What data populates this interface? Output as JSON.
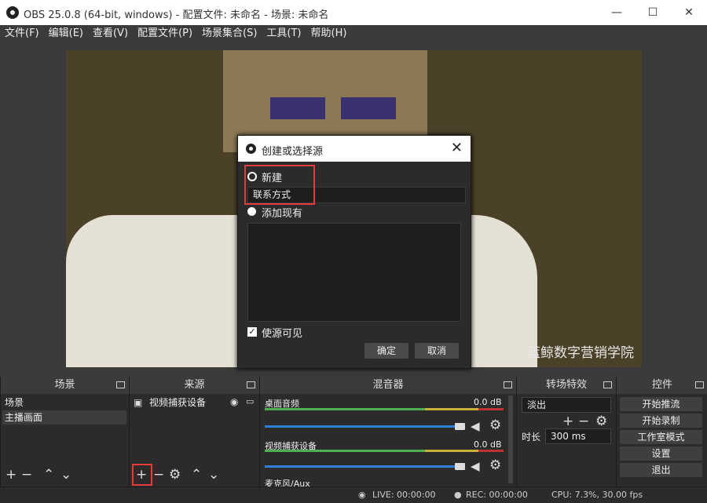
{
  "window": {
    "title": "OBS 25.0.8 (64-bit, windows) - 配置文件: 未命名 - 场景: 未命名"
  },
  "menu": [
    "文件(F)",
    "编辑(E)",
    "查看(V)",
    "配置文件(P)",
    "场景集合(S)",
    "工具(T)",
    "帮助(H)"
  ],
  "preview": {
    "watermark": "蓝鲸数字营销学院"
  },
  "dialog": {
    "title": "创建或选择源",
    "create_new_label": "新建",
    "name_value": "联系方式",
    "add_existing_label": "添加现有",
    "visible_label": "使源可见",
    "ok_label": "确定",
    "cancel_label": "取消"
  },
  "docks": {
    "scenes": {
      "title": "场景",
      "items": [
        "场景",
        "主播画面"
      ]
    },
    "sources": {
      "title": "来源",
      "items": [
        "视频捕获设备"
      ]
    },
    "mixer": {
      "title": "混音器",
      "channels": [
        {
          "name": "桌面音频",
          "level": "0.0 dB"
        },
        {
          "name": "视频捕获设备",
          "level": "0.0 dB"
        },
        {
          "name": "麦克风/Aux"
        }
      ]
    },
    "transitions": {
      "title": "转场特效",
      "type": "淡出",
      "duration_label": "时长",
      "duration": "300 ms"
    },
    "controls": {
      "title": "控件",
      "buttons": [
        "开始推流",
        "开始录制",
        "工作室模式",
        "设置",
        "退出"
      ]
    }
  },
  "status": {
    "live": "LIVE: 00:00:00",
    "rec": "REC: 00:00:00",
    "cpu": "CPU: 7.3%, 30.00 fps"
  },
  "colors": {
    "accent_blue": "#2f7ed8",
    "highlight_red": "#e23b3b",
    "meter_green": "#4caf50"
  }
}
